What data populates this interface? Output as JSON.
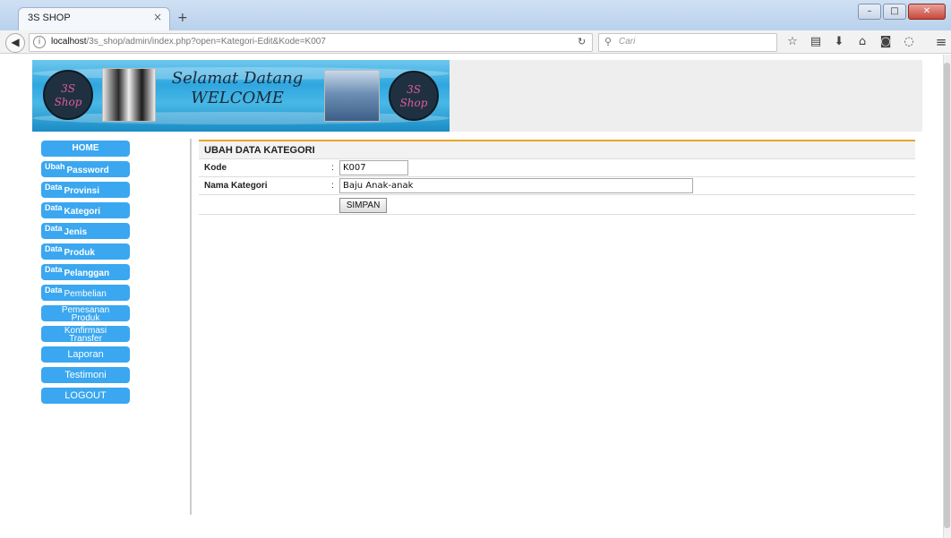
{
  "browser": {
    "tab_title": "3S SHOP",
    "tab_close": "×",
    "new_tab": "+",
    "url_host": "localhost",
    "url_path": "/3s_shop/admin/index.php?open=Kategori-Edit&Kode=K007",
    "search_placeholder": "Cari"
  },
  "banner": {
    "logo_line1": "3S",
    "logo_line2": "Shop",
    "greeting": "Selamat Datang",
    "welcome": "WELCOME"
  },
  "sidebar": {
    "home": "HOME",
    "ubah_password": {
      "small": "Ubah",
      "big": "Password"
    },
    "data_provinsi": {
      "small": "Data",
      "big": "Provinsi"
    },
    "data_kategori": {
      "small": "Data",
      "big": "Kategori"
    },
    "data_jenis": {
      "small": "Data",
      "big": "Jenis"
    },
    "data_produk": {
      "small": "Data",
      "big": "Produk"
    },
    "data_pelanggan": {
      "small": "Data",
      "big": "Pelanggan"
    },
    "data_pembelian": {
      "small": "Data",
      "big": "Pembelian"
    },
    "pemesanan": {
      "line1": "Pemesanan",
      "line2": "Produk"
    },
    "konfirmasi": {
      "line1": "Konfirmasi",
      "line2": "Transfer"
    },
    "laporan": "Laporan",
    "testimoni": "Testimoni",
    "logout": "LOGOUT"
  },
  "form": {
    "title": "UBAH DATA KATEGORI",
    "kode_label": "Kode",
    "kode_value": "K007",
    "nama_label": "Nama Kategori",
    "nama_value": "Baju Anak-anak",
    "colon": ":",
    "save_label": "SIMPAN"
  },
  "colors": {
    "accent": "#e8a628",
    "sidebar_button": "#3aa7f0"
  }
}
